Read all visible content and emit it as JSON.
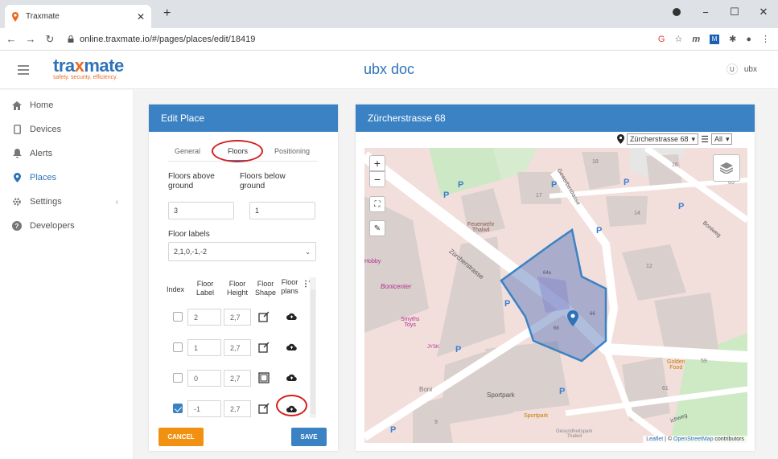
{
  "browser": {
    "tab_title": "Traxmate",
    "url": "online.traxmate.io/#/pages/places/edit/18419"
  },
  "header": {
    "logo_name_left": "tra",
    "logo_name_x": "x",
    "logo_name_right": "mate",
    "logo_tagline": "safety. security. efficiency.",
    "page_title": "ubx doc",
    "user_initial": "U",
    "user_name": "ubx"
  },
  "sidebar": {
    "items": [
      {
        "label": "Home",
        "icon": "home-icon"
      },
      {
        "label": "Devices",
        "icon": "device-icon"
      },
      {
        "label": "Alerts",
        "icon": "bell-icon"
      },
      {
        "label": "Places",
        "icon": "map-pin-icon",
        "active": true
      },
      {
        "label": "Settings",
        "icon": "gear-icon",
        "chevron": "‹"
      },
      {
        "label": "Developers",
        "icon": "help-icon"
      }
    ]
  },
  "edit_panel": {
    "title": "Edit Place",
    "tabs": [
      "General",
      "Floors",
      "Positioning"
    ],
    "active_tab": "Floors",
    "floors_above_label": "Floors above ground",
    "floors_below_label": "Floors below ground",
    "floors_above_value": "3",
    "floors_below_value": "1",
    "floor_labels_label": "Floor labels",
    "floor_labels_value": "2,1,0,-1,-2",
    "table_headers": {
      "index": "Index",
      "floor_label": "Floor Label",
      "floor_height": "Floor Height",
      "floor_shape": "Floor Shape",
      "floor_plans": "Floor plans"
    },
    "rows": [
      {
        "checked": false,
        "label": "2",
        "height": "2,7",
        "shape": "edit-shape-icon"
      },
      {
        "checked": false,
        "label": "1",
        "height": "2,7",
        "shape": "edit-shape-icon"
      },
      {
        "checked": false,
        "label": "0",
        "height": "2,7",
        "shape": "square-shape-icon"
      },
      {
        "checked": true,
        "label": "-1",
        "height": "2,7",
        "shape": "edit-shape-icon"
      }
    ],
    "cancel_label": "CANCEL",
    "save_label": "SAVE"
  },
  "map_panel": {
    "title": "Zürcherstrasse 68",
    "place_select": "Zürcherstrasse 68",
    "filter_select": "All",
    "labels": {
      "feuerwehr": "Feuerwehr\nThalwil",
      "hobby": "Hobby",
      "bonicenter": "Bonicenter",
      "smyths": "Smyths\nToys",
      "jysk": "JYSK",
      "boni": "Boni",
      "sportpark": "Sportpark",
      "sportpark2": "Sportpark",
      "golden_food": "Golden\nFood",
      "zurcherstrasse": "Zürcherstrasse",
      "gewerbestrasse": "Gewerbestrasse",
      "boniweg": "Boniweg",
      "gesundheitspark": "Gesundheitspark\nThalwil",
      "ichweg": "ichweg",
      "n18": "18",
      "n16": "16",
      "n65": "65",
      "n17": "17",
      "n14": "14",
      "n12": "12",
      "n64a": "64a",
      "n68": "68",
      "n66": "66",
      "n59": "59",
      "n61": "61",
      "n9": "9"
    },
    "attribution_leaflet": "Leaflet",
    "attribution_sep": " | © ",
    "attribution_osm": "OpenStreetMap",
    "attribution_tail": " contributors"
  },
  "colors": {
    "brand_blue": "#2e73b8",
    "panel_header": "#3b82c4",
    "cancel_orange": "#f29111",
    "annotation_red": "#d42020",
    "place_polygon": "#3b82c4"
  }
}
